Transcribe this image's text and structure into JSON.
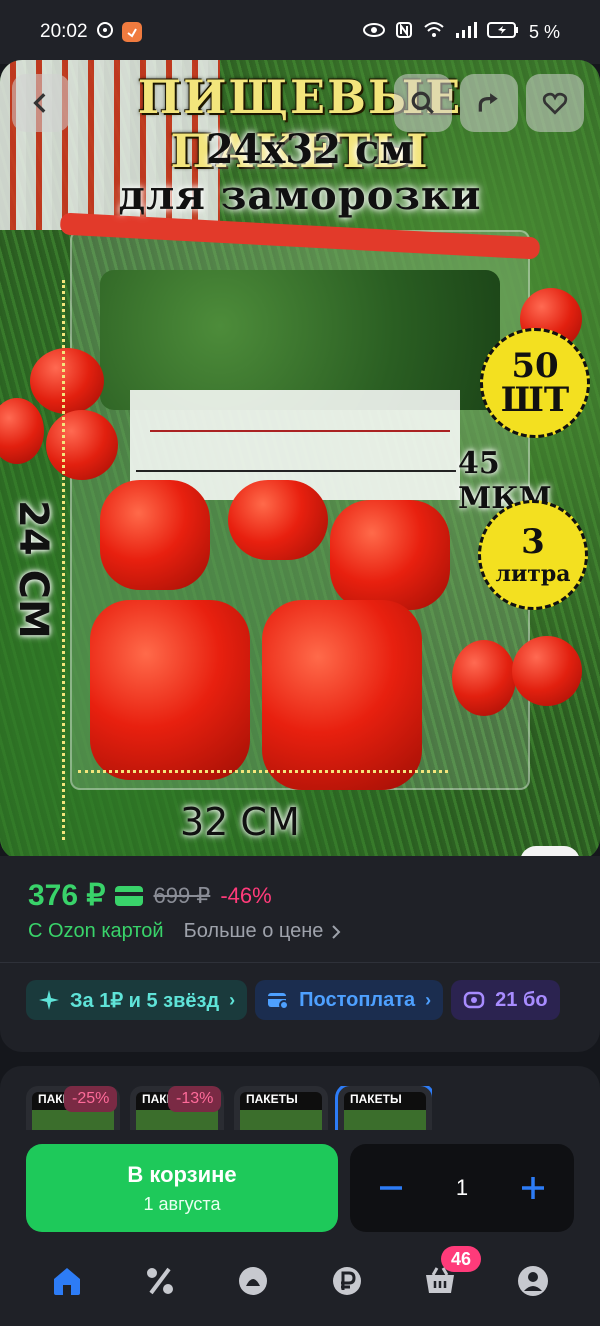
{
  "status_bar": {
    "time": "20:02",
    "battery": "5 %",
    "icons": [
      "whatsapp-icon",
      "app-badge-icon",
      "eye-icon",
      "nfc-icon",
      "wifi-icon",
      "signal-icon",
      "battery-icon"
    ]
  },
  "hero": {
    "title_line1": "ПИЩЕВЫЕ ПАКЕТЫ",
    "title_line2": "24х32 см",
    "title_line3": "для заморозки",
    "badge_count": "50",
    "badge_count_unit": "ШТ",
    "thickness": "45 МКМ",
    "badge_volume": "3",
    "badge_volume_unit": "литра",
    "dim_vertical": "24 СМ",
    "dim_horizontal": "32 СМ",
    "buttons": [
      "back-icon",
      "search-icon",
      "share-icon",
      "heart-icon"
    ]
  },
  "price": {
    "current": "376 ₽",
    "old": "699 ₽",
    "discount": "-46%",
    "card_label": "С Ozon картой",
    "more_label": "Больше о цене",
    "accent": "#39d36a",
    "discount_color": "#ff3b7a"
  },
  "chips": [
    {
      "label": "За 1₽ и 5 звёзд",
      "icon": "sparkle-icon"
    },
    {
      "label": "Постоплата",
      "icon": "wallet-icon"
    },
    {
      "label": "21 бо",
      "icon": "bonus-icon"
    }
  ],
  "gallery": {
    "thumbs": [
      {
        "text": "ПАКЕ",
        "discount": "-25%"
      },
      {
        "text": "ПАКЕ",
        "discount": "-13%"
      },
      {
        "text": "ПАКЕТЫ",
        "discount": ""
      },
      {
        "text": "ПАКЕТЫ",
        "discount": ""
      }
    ]
  },
  "action": {
    "cart_label": "В корзине",
    "delivery": "1 августа",
    "quantity": "1",
    "button_color": "#1ec95a"
  },
  "nav": {
    "items": [
      "home-icon",
      "percent-icon",
      "fresh-icon",
      "ruble-icon",
      "cart-icon",
      "profile-icon"
    ],
    "cart_badge": "46"
  }
}
